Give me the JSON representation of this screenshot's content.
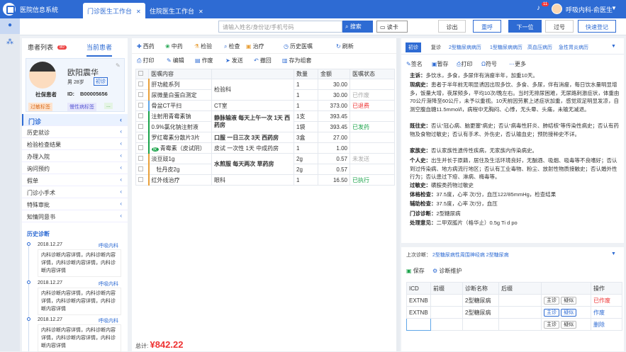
{
  "app": {
    "title": "医院信息系统",
    "tabs": [
      {
        "label": "门诊医生工作台"
      },
      {
        "label": "住院医生工作台"
      }
    ],
    "close": "✕",
    "badge": "11",
    "user": "呼吸内科-俞医生"
  },
  "toolbar": {
    "search_placeholder": "请输入姓名/身份证/手机号码",
    "search_btn": "搜索",
    "card_btn": "读卡",
    "actions": [
      "诊出",
      "重呼",
      "下一位",
      "过号",
      "快速登记"
    ]
  },
  "left": {
    "tab_list": "患者列表",
    "tab_count": "80",
    "tab_current": "当前患者",
    "patient": {
      "name": "欧阳震华",
      "sex_age": "男 28岁",
      "visit": "初诊",
      "insurance": "社保患者",
      "id_label": "ID:",
      "id": "B00005656",
      "tags": [
        "过敏标签",
        "慢性病标签",
        "..."
      ]
    },
    "menu": [
      {
        "label": "门诊"
      },
      {
        "label": "历史就诊"
      },
      {
        "label": "检验检查结果"
      },
      {
        "label": "办理入院"
      },
      {
        "label": "询问预约"
      },
      {
        "label": "假单"
      },
      {
        "label": "门诊小手术"
      },
      {
        "label": "特殊审批"
      },
      {
        "label": "知情同意书"
      }
    ],
    "history_title": "历史诊断",
    "history": [
      {
        "date": "2018.12.27",
        "dept": "呼吸内科",
        "text": "内科诊断内容详情，内科诊断内容详情，内科诊断内容详情，内科诊断内容详情"
      },
      {
        "date": "2018.12.27",
        "dept": "呼吸内科",
        "text": "内科诊断内容详情，内科诊断内容详情，内科诊断内容详情，内科诊断内容详情"
      },
      {
        "date": "2018.12.27",
        "dept": "呼吸内科",
        "text": "内科诊断内容详情，内科诊断内容详情，内科诊断内容详情，内科诊断内容详情"
      }
    ]
  },
  "middle": {
    "top_btns": [
      "西药",
      "中药",
      "检验",
      "检查",
      "治疗",
      "历史医嘱",
      "刷新"
    ],
    "sub_btns": [
      "打印",
      "编辑",
      "作废",
      "发送",
      "撤回",
      "存为组套"
    ],
    "headers": [
      "医嘱内容",
      "",
      "数量",
      "金额",
      "医嘱状态"
    ],
    "rows": [
      {
        "name": "肝功能系列",
        "group": "检验科",
        "qty": "1",
        "amt": "30.00",
        "status": ""
      },
      {
        "name": "尿微量白蛋白测定",
        "group": "",
        "qty": "1",
        "amt": "30.00",
        "status": "已作废"
      },
      {
        "name": "骨盆CT平扫",
        "group": "CT室",
        "qty": "1",
        "amt": "373.00",
        "status": "已退费"
      },
      {
        "name": "注射用青霉素钠",
        "group": "静脉输液 每天上午一次 1天 西药房",
        "qty": "1支",
        "amt": "393.45",
        "status": ""
      },
      {
        "name": "0.9%氯化钠注射液",
        "group": "",
        "qty": "1袋",
        "amt": "393.45",
        "status": "已发药"
      },
      {
        "name": "罗红霉素分散片3片",
        "group": "口服 一日三次 3天 西药房",
        "qty": "3盒",
        "amt": "27.00",
        "status": ""
      },
      {
        "name": "青霉素（皮试阴）",
        "group": "皮试 一次性 1天 中成药房",
        "qty": "1",
        "amt": "1.00",
        "status": ""
      },
      {
        "name": "淡豆豉1g",
        "group": "水煎服 每天两次 草药房",
        "qty": "2g",
        "amt": "0.57",
        "status": "未发送"
      },
      {
        "name": "牡丹皮2g",
        "group": "",
        "qty": "2g",
        "amt": "0.57",
        "status": ""
      },
      {
        "name": "红外线治疗",
        "group": "眼科",
        "qty": "1",
        "amt": "16.50",
        "status": "已执行"
      }
    ],
    "total_label": "总计:",
    "total": "¥842.22"
  },
  "right": {
    "tabs": [
      "初诊",
      "复诊",
      "2型糖尿病病历",
      "1型糖尿病病历",
      "高血压病历",
      "急性胃炎病历"
    ],
    "btns": [
      "签名",
      "暂存",
      "打印",
      "符号",
      "更多"
    ],
    "record": [
      {
        "k": "主诉：",
        "v": "多饮水，多食，多尿伴有消瘦半年，加重10天。"
      },
      {
        "k": "现病史：",
        "v": "患者于半年前无明显诱因出现多饮、多食、多尿，伴有消瘦，每日饮水量明显增多，饭量大增，夜尿频多，平均10次/晚左右。当时无排尿困难，无尿路刺激症状，体重由70公斤渐降至60公斤，未予以重视。10天前因劳累上述症状加重，感觉双足明显发凉，自测空腹血糖11.5mmol/l，病程中无胸闷、心悸，无头晕、头痛，未输无减退。"
      },
      {
        "k": "既往史：",
        "v": "否认“冠心病、脑更塞”病史；否认“病毒性肝炎、肺结核”等传染性病史；否认有药物及食物过敏史；否认有手术、外伤史，否认输血史；预防接种史不详。"
      },
      {
        "k": "家族史：",
        "v": "否认家族性遗传性疾病，无家族内传染病史。"
      },
      {
        "k": "个人史：",
        "v": "出生并长于原籍，居住及生活环境良好，无酗酒、吸烟、吸毒等不良嗜好；否认到过传染病、地方病流行地区；否认有工业毒物、粉尘、放射性物质接触史；否认婚外性行为；否认患过下疳、淋病、梅毒等。"
      },
      {
        "k": "过敏史：",
        "v": "磺胺类药物过敏史"
      },
      {
        "k": "体格检查：",
        "v": "37.5度，心率 次/分，血压122/85mmHg，检查结果"
      },
      {
        "k": "辅助检查：",
        "v": "37.5度，心率 次/分，血压"
      },
      {
        "k": "门诊诊断：",
        "v": "2型糖尿病"
      },
      {
        "k": "处理意见：",
        "v": "二甲双胍片（格华止）0.5g Ti d po"
      }
    ],
    "last_dx_label": "上次诊断：",
    "last_dx": "2型糖尿病性周围神经病 2型糖尿病",
    "save": "保存",
    "maintain": "诊断维护",
    "dx_headers": [
      "ICD",
      "前缀",
      "诊断名称",
      "后缀",
      "",
      "操作"
    ],
    "dx": [
      {
        "icd": "EXTNB",
        "name": "2型糖尿病",
        "op": "已作废"
      },
      {
        "icd": "EXTNB",
        "name": "2型糖尿病",
        "op": "作废"
      },
      {
        "icd": "",
        "name": "",
        "op": "删除"
      }
    ],
    "main": "主诊",
    "doubt": "疑似"
  }
}
